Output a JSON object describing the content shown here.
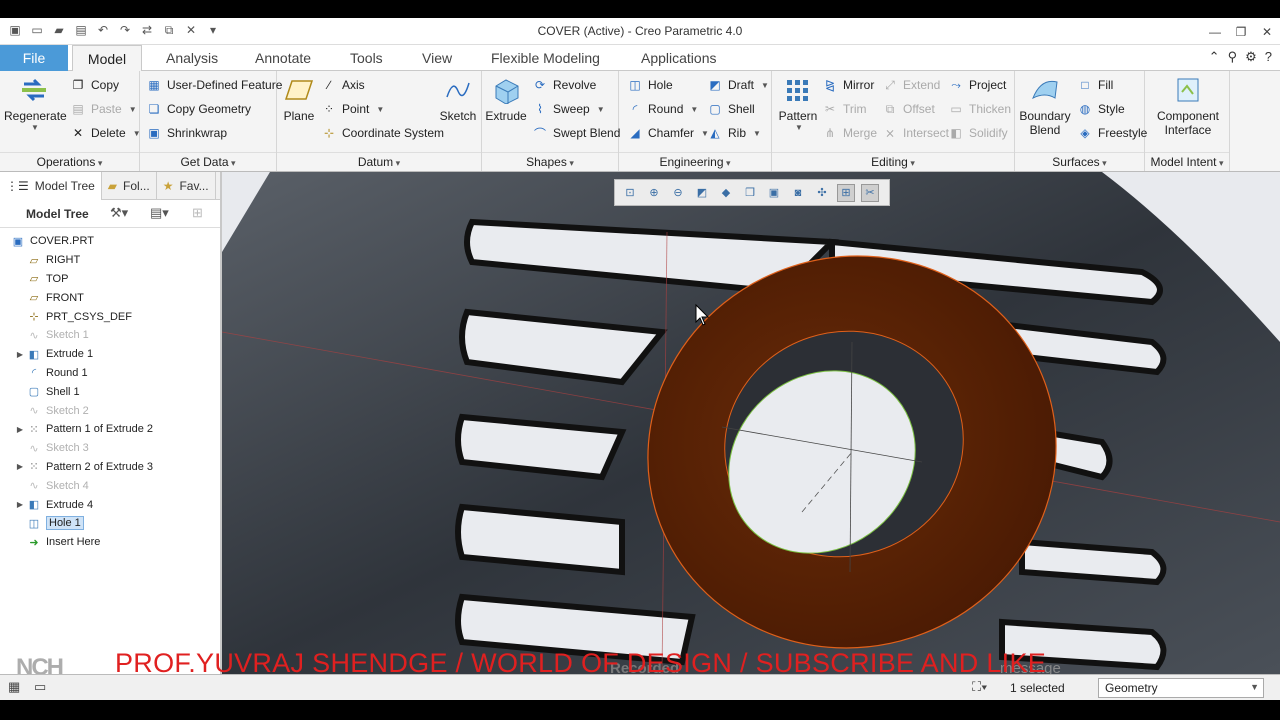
{
  "window": {
    "title": "COVER (Active) - Creo Parametric 4.0"
  },
  "tabs": [
    "File",
    "Model",
    "Analysis",
    "Annotate",
    "Tools",
    "View",
    "Flexible Modeling",
    "Applications"
  ],
  "active_tab": "Model",
  "ribbon": {
    "operations": {
      "label": "Operations",
      "regenerate": "Regenerate",
      "copy": "Copy",
      "paste": "Paste",
      "delete": "Delete"
    },
    "getdata": {
      "label": "Get Data",
      "udf": "User-Defined Feature",
      "copy_geometry": "Copy Geometry",
      "shrinkwrap": "Shrinkwrap"
    },
    "datum": {
      "label": "Datum",
      "plane": "Plane",
      "axis": "Axis",
      "point": "Point",
      "csys": "Coordinate System",
      "sketch": "Sketch"
    },
    "shapes": {
      "label": "Shapes",
      "extrude": "Extrude",
      "revolve": "Revolve",
      "sweep": "Sweep",
      "swept_blend": "Swept Blend"
    },
    "engineering": {
      "label": "Engineering",
      "hole": "Hole",
      "round": "Round",
      "chamfer": "Chamfer",
      "draft": "Draft",
      "shell": "Shell",
      "rib": "Rib"
    },
    "editing": {
      "label": "Editing",
      "pattern": "Pattern",
      "mirror": "Mirror",
      "trim": "Trim",
      "merge": "Merge",
      "extend": "Extend",
      "offset": "Offset",
      "intersect": "Intersect",
      "project": "Project",
      "thicken": "Thicken",
      "solidify": "Solidify"
    },
    "surfaces": {
      "label": "Surfaces",
      "boundary_blend": "Boundary Blend",
      "fill": "Fill",
      "style": "Style",
      "freestyle": "Freestyle"
    },
    "model_intent": {
      "label": "Model Intent",
      "component_interface": "Component Interface"
    }
  },
  "panel": {
    "tabs": [
      "Model Tree",
      "Fol...",
      "Fav..."
    ],
    "title": "Model Tree",
    "items": [
      {
        "label": "COVER.PRT",
        "icon": "part-icon",
        "state": "normal",
        "expand": false
      },
      {
        "label": "RIGHT",
        "icon": "datum-plane-icon",
        "state": "normal",
        "expand": false
      },
      {
        "label": "TOP",
        "icon": "datum-plane-icon",
        "state": "normal",
        "expand": false
      },
      {
        "label": "FRONT",
        "icon": "datum-plane-icon",
        "state": "normal",
        "expand": false
      },
      {
        "label": "PRT_CSYS_DEF",
        "icon": "csys-icon",
        "state": "normal",
        "expand": false
      },
      {
        "label": "Sketch 1",
        "icon": "sketch-icon",
        "state": "dim",
        "expand": false
      },
      {
        "label": "Extrude 1",
        "icon": "extrude-icon",
        "state": "normal",
        "expand": true
      },
      {
        "label": "Round 1",
        "icon": "round-icon",
        "state": "normal",
        "expand": false
      },
      {
        "label": "Shell 1",
        "icon": "shell-icon",
        "state": "normal",
        "expand": false
      },
      {
        "label": "Sketch 2",
        "icon": "sketch-icon",
        "state": "dim",
        "expand": false
      },
      {
        "label": "Pattern 1 of Extrude 2",
        "icon": "pattern-icon",
        "state": "normal",
        "expand": true
      },
      {
        "label": "Sketch 3",
        "icon": "sketch-icon",
        "state": "dim",
        "expand": false
      },
      {
        "label": "Pattern 2 of Extrude 3",
        "icon": "pattern-icon",
        "state": "normal",
        "expand": true
      },
      {
        "label": "Sketch 4",
        "icon": "sketch-icon",
        "state": "dim",
        "expand": false
      },
      {
        "label": "Extrude 4",
        "icon": "extrude-icon",
        "state": "normal",
        "expand": true
      },
      {
        "label": "Hole 1",
        "icon": "hole-icon",
        "state": "selected",
        "expand": false
      },
      {
        "label": "Insert Here",
        "icon": "insert-arrow-icon",
        "state": "normal",
        "expand": false
      }
    ]
  },
  "overlay": {
    "watermark": "PROF.YUVRAJ SHENDGE / WORLD OF DESIGN / SUBSCRIBE AND LIKE",
    "recorded": "Recorded",
    "message": "message"
  },
  "status": {
    "selected": "1 selected",
    "filter": "Geometry"
  },
  "colors": {
    "accent": "#4b9ad8",
    "feature": "#5a2205",
    "highlight": "#e0601a",
    "watermark": "#e02020"
  }
}
